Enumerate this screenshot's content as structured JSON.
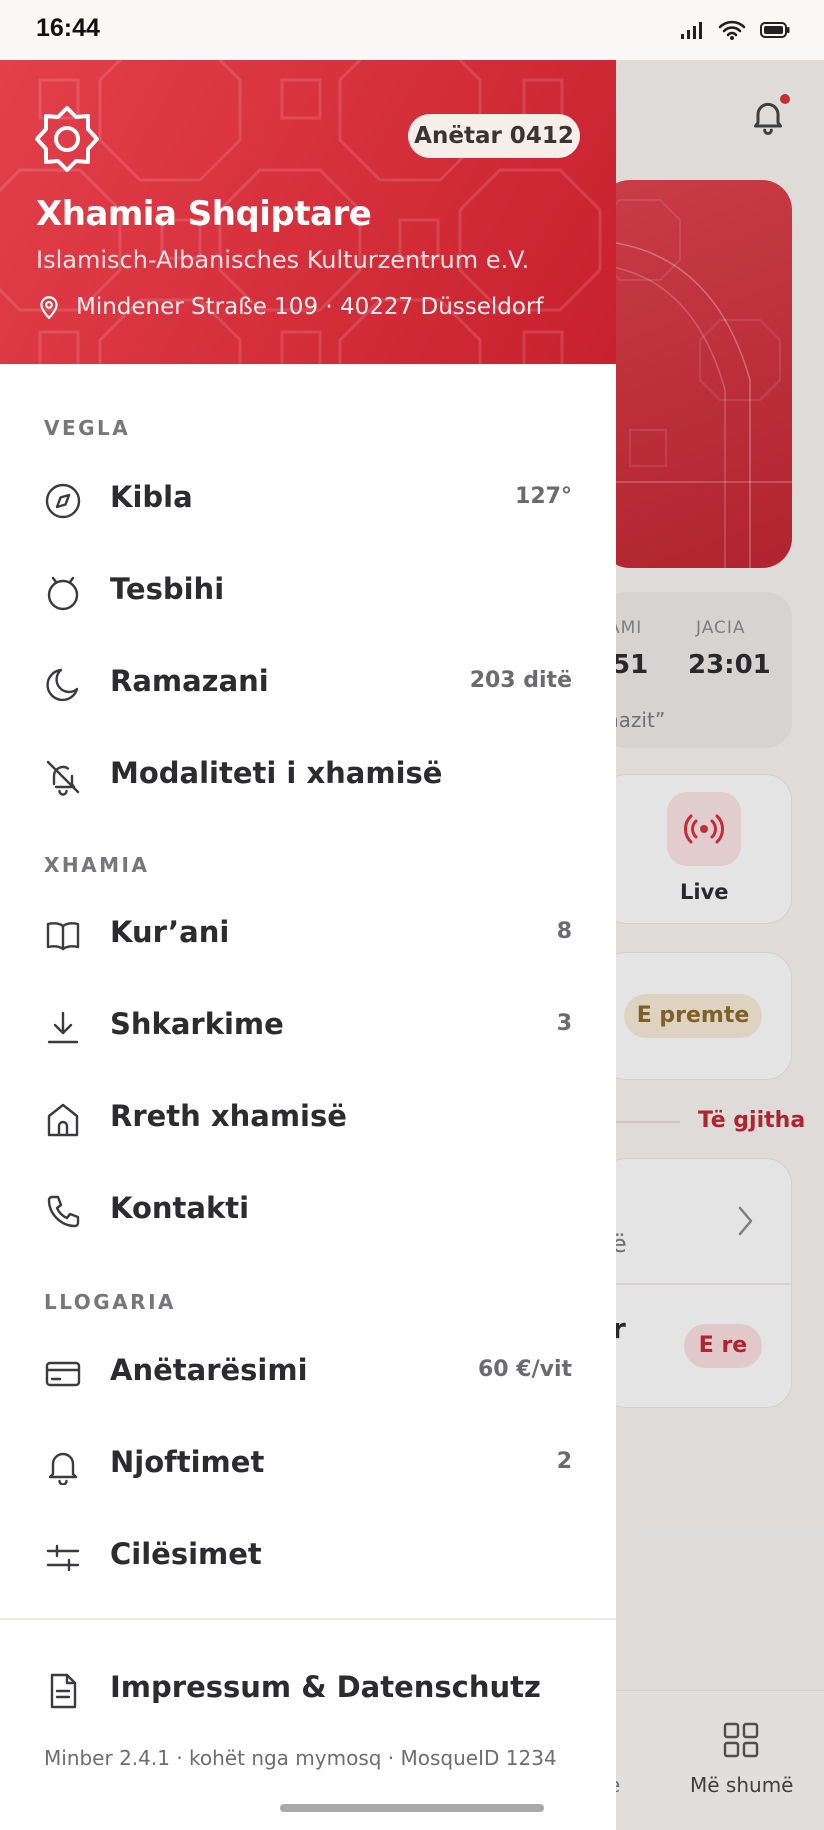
{
  "status_bar": {
    "time": "16:44"
  },
  "background": {
    "prayer_labels": [
      "AMI",
      "JACIA"
    ],
    "prayer_values": [
      "51",
      "23:01"
    ],
    "prayer_caption": "nazit”",
    "live_label": "Live",
    "friday_pill": "E premte",
    "see_all": "Të gjitha",
    "list_fragment_1": "ë",
    "list_fragment_2": "r",
    "new_pill": "E re",
    "nav_fragment": "e",
    "nav_more": "Më shumë"
  },
  "drawer": {
    "member_badge": "Anëtar 0412",
    "mosque_name": "Xhamia Shqiptare",
    "mosque_subtitle": "Islamisch-Albanisches Kulturzentrum e.V.",
    "address": "Mindener Straße 109 · 40227 Düsseldorf",
    "sections": {
      "tools": "VEGLA",
      "mosque": "XHAMIA",
      "account": "LLOGARIA"
    },
    "items": {
      "kibla": {
        "label": "Kibla",
        "meta": "127°"
      },
      "tesbihi": {
        "label": "Tesbihi"
      },
      "ramazani": {
        "label": "Ramazani",
        "meta": "203 ditë"
      },
      "mode": {
        "label": "Modaliteti i xhamisë"
      },
      "kurani": {
        "label": "Kur’ani",
        "meta": "8"
      },
      "downloads": {
        "label": "Shkarkime",
        "meta": "3"
      },
      "about": {
        "label": "Rreth xhamisë"
      },
      "contact": {
        "label": "Kontakti"
      },
      "membership": {
        "label": "Anëtarësimi",
        "meta": "60 €/vit"
      },
      "notifications": {
        "label": "Njoftimet",
        "meta": "2"
      },
      "settings": {
        "label": "Cilësimet"
      },
      "imprint": {
        "label": "Impressum & Datenschutz"
      }
    },
    "footer": "Minber 2.4.1 · kohët nga mymosq · MosqueID 1234"
  },
  "colors": {
    "brand_red": "#d6303c",
    "text_dark": "#2b2b30",
    "muted": "#76767c"
  }
}
